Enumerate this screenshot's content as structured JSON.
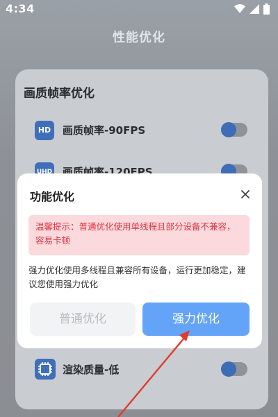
{
  "status_bar": {
    "time": "4:34"
  },
  "header": {
    "title": "性能优化"
  },
  "section": {
    "title": "画质帧率优化"
  },
  "options": [
    {
      "icon_text": "HD",
      "label": "画质帧率-90FPS"
    },
    {
      "icon_text": "UHD",
      "label": "画质帧率-120FPS"
    }
  ],
  "render_option": {
    "label": "渲染质量-低"
  },
  "dialog": {
    "title": "功能优化",
    "warning": "温馨提示：普通优化使用单线程且部分设备不兼容，容易卡顿",
    "description": "强力优化使用多线程且兼容所有设备，运行更加稳定，建议您使用强力优化",
    "normal_button": "普通优化",
    "strong_button": "强力优化"
  },
  "colors": {
    "accent": "#63a4f8",
    "warning_text": "#e0343f",
    "warning_bg": "#fbd9dc",
    "annotation": "#e23a2e"
  },
  "icons": [
    "wifi-icon",
    "signal-icon",
    "battery-icon",
    "close-icon",
    "chip-icon",
    "arrow-annotation"
  ]
}
